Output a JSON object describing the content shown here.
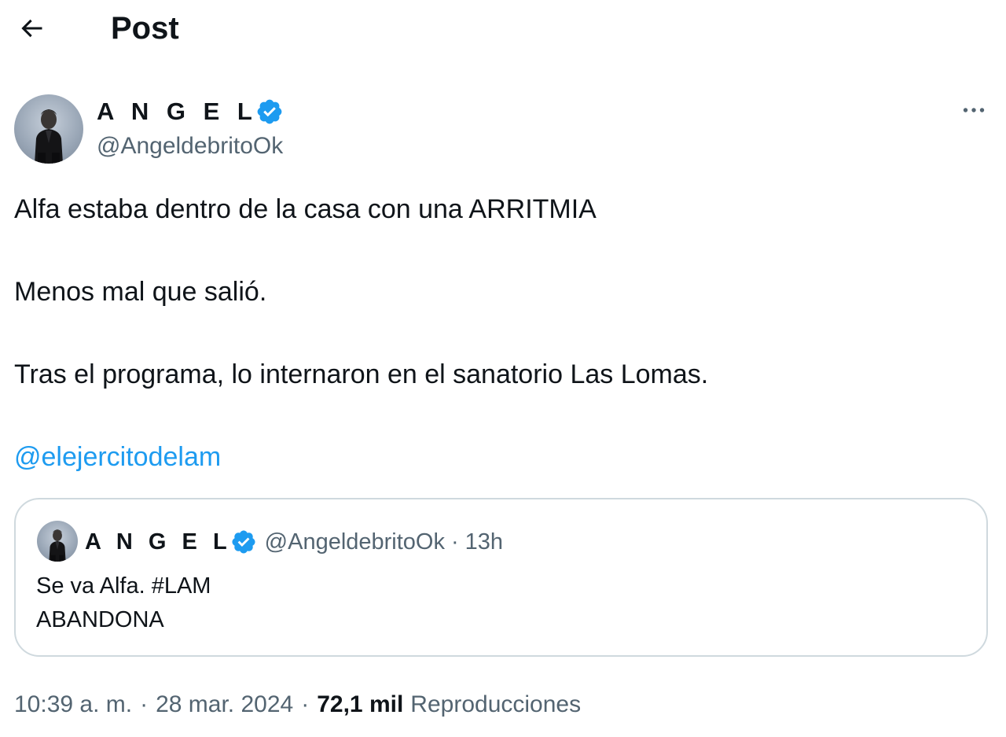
{
  "header": {
    "title": "Post"
  },
  "post": {
    "author": {
      "name": "A N G E L",
      "handle": "@AngeldebritoOk",
      "verified": true
    },
    "text_lines": [
      "Alfa estaba dentro de la casa con una ARRITMIA",
      "Menos mal que salió.",
      "Tras el programa, lo internaron en el sanatorio Las Lomas."
    ],
    "mention": "@elejercitodelam",
    "quoted": {
      "author_name": "A N G E L",
      "handle": "@AngeldebritoOk",
      "separator": "·",
      "time": "13h",
      "text_lines": [
        "Se va Alfa. #LAM",
        "ABANDONA"
      ]
    },
    "meta": {
      "time": "10:39 a. m.",
      "date": "28 mar. 2024",
      "separator": "·",
      "views_count": "72,1 mil",
      "views_label": "Reproducciones"
    }
  },
  "colors": {
    "text_primary": "#0f1419",
    "text_secondary": "#536471",
    "link": "#1d9bf0",
    "verified_badge": "#1d9bf0",
    "border": "#cfd9de"
  },
  "icons": {
    "back": "arrow-left-icon",
    "verified": "verified-badge-icon",
    "more": "more-horizontal-icon"
  }
}
